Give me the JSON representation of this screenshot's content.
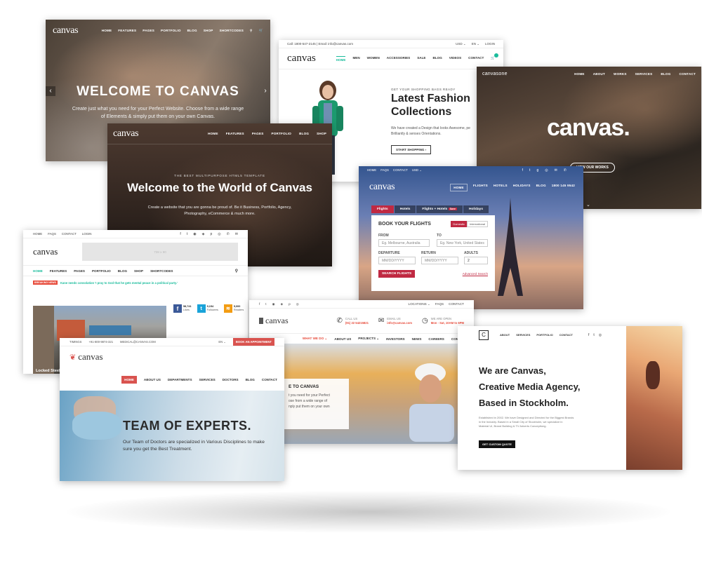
{
  "card1": {
    "logo": "canvas",
    "nav": [
      "HOME",
      "FEATURES",
      "PAGES",
      "PORTFOLIO",
      "BLOG",
      "SHOP",
      "SHORTCODES"
    ],
    "heading": "WELCOME TO CANVAS",
    "sub1": "Create just what you need for your Perfect Website. Choose from a wide range",
    "sub2": "of Elements & simply put them on your own Canvas.",
    "prev": "‹",
    "next": "›",
    "cart": "🛒"
  },
  "card2": {
    "topbar": "Call: 1800-547-2145 | Email: info@canvas.com",
    "currency": "USD ⌄",
    "lang": "EN ⌄",
    "login": "LOGIN",
    "logo": "canvas",
    "nav": [
      "HOME",
      "MEN",
      "WOMEN",
      "ACCESSORIES",
      "SALE",
      "BLOG",
      "VIDEOS",
      "CONTACT"
    ],
    "kicker": "GET YOUR SHOPPING BAGS READY",
    "title1": "Latest Fashion",
    "title2": "Collections",
    "desc1": "We have created a Design that looks Awesome, pe",
    "desc2": "Brilliantly & senses Orientations.",
    "cta": "START SHOPPING ›"
  },
  "card3": {
    "logo": "canvasone",
    "nav": [
      "HOME",
      "ABOUT",
      "WORKS",
      "SERVICES",
      "BLOG",
      "CONTACT"
    ],
    "title": "canvas.",
    "cta": "VIEW OUR WORKS"
  },
  "card4": {
    "logo": "canvas",
    "nav": [
      "HOME",
      "FEATURES",
      "PAGES",
      "PORTFOLIO",
      "BLOG",
      "SHOP"
    ],
    "kicker": "THE BEST MULTIPURPOSE HTML5 TEMPLATE",
    "title": "Welcome to the World of Canvas",
    "desc1": "Create a website that you are gonna be proud of. Be it Business, Portfolio, Agency,",
    "desc2": "Photography, eCommerce & much more."
  },
  "card5": {
    "topnav": [
      "HOME",
      "FAQS",
      "CONTACT",
      "USD ⌄"
    ],
    "logo": "canvas",
    "nav": [
      "HOME",
      "FLIGHTS",
      "HOTELS",
      "HOLIDAYS",
      "BLOG"
    ],
    "phone": "1800 145 9542",
    "tabs": [
      "Flights",
      "Hotels",
      "Flights + Hotels",
      "Holidays"
    ],
    "tab_badge": "Save",
    "form_title": "BOOK YOUR FLIGHTS",
    "domestic": "Domestic",
    "international": "International",
    "from_label": "FROM",
    "to_label": "TO",
    "from_ph": "Eg. Melbourne, Australia",
    "to_ph": "Eg. New York, United States",
    "dep_label": "DEPARTURE",
    "ret_label": "RETURN",
    "adults_label": "ADULTS",
    "date_ph": "MM/DD/YYYY",
    "adults_val": "2",
    "search": "SEARCH FLIGHTS",
    "advanced": "Advanced Search"
  },
  "card6": {
    "topnav": [
      "HOME",
      "FAQS",
      "CONTACT",
      "LOGIN"
    ],
    "logo": "canvas",
    "ad": "728 x 90",
    "nav": [
      "HOME",
      "FEATURES",
      "PAGES",
      "PORTFOLIO",
      "BLOG",
      "SHOP",
      "SHORTCODES"
    ],
    "breaking": "BREAKING NEWS",
    "ticker": "Kane needs consolation 'I pray to God that he gets mental peace in a political party.'",
    "fb_count": "58,741",
    "fb_label": "Likes",
    "tw_count": "9,154",
    "tw_label": "Followers",
    "rss_count": "5,000",
    "rss_label": "Readers",
    "caption": "Locked Steel"
  },
  "card7": {
    "topnav": [
      "LOCATIONS ⌄",
      "FAQS",
      "CONTACT"
    ],
    "logo": "canvas",
    "call_label": "CALL US",
    "call_val": "(91) 22 54215821",
    "email_label": "EMAIL US",
    "email_val": "info@canvas.com",
    "open_label": "WE ARE OPEN",
    "open_val": "Mon - Sat, 10AM to 6PM",
    "nav": [
      "WHAT WE DO ⌄",
      "ABOUT US",
      "PROJECTS ⌄",
      "INVESTORS",
      "NEWS",
      "CAREERS",
      "CONTACT"
    ],
    "heading": "E TO CANVAS",
    "desc1": "t you need for your Perfect",
    "desc2": "ose from a wide range of",
    "desc3": "nply put them on your own"
  },
  "card8": {
    "topnav": [
      "TIMINGS",
      "+91-800-9874-321",
      "MEDICAL@CANVAS.COM"
    ],
    "lang": "EN ⌄",
    "appointment": "BOOK AN APPOINTMENT",
    "logo": "canvas",
    "nav": [
      "HOME",
      "ABOUT US",
      "DEPARTMENTS",
      "SERVICES",
      "DOCTORS",
      "BLOG",
      "CONTACT"
    ],
    "title": "TEAM OF EXPERTS.",
    "desc1": "Our Team of Doctors are specialized in Various Disciplines to make",
    "desc2": "sure you get the Best Treatment."
  },
  "card9": {
    "logo": "C",
    "nav": [
      "ABOUT",
      "SERVICES",
      "PORTFOLIO",
      "CONTACT"
    ],
    "h1": "We are Canvas,",
    "h2": "Creative Media Agency,",
    "h3": "Based in Stockholm.",
    "p1": "Established in 2002. We have Designed and Directed for the Biggest Brands",
    "p2": "in the Industry. Based in a Small City of Stockholm, we specialize in",
    "p3": "Material UI, Brand Building & TV Adverts Conceptiong.",
    "cta": "GET CUSTOM QUOTE"
  },
  "colors": {
    "accent_teal": "#1abc9c",
    "flight_red": "#c02942",
    "construction_red": "#e74c3c",
    "medical_red": "#d9534f",
    "news_blue": "#1aa3d9"
  }
}
